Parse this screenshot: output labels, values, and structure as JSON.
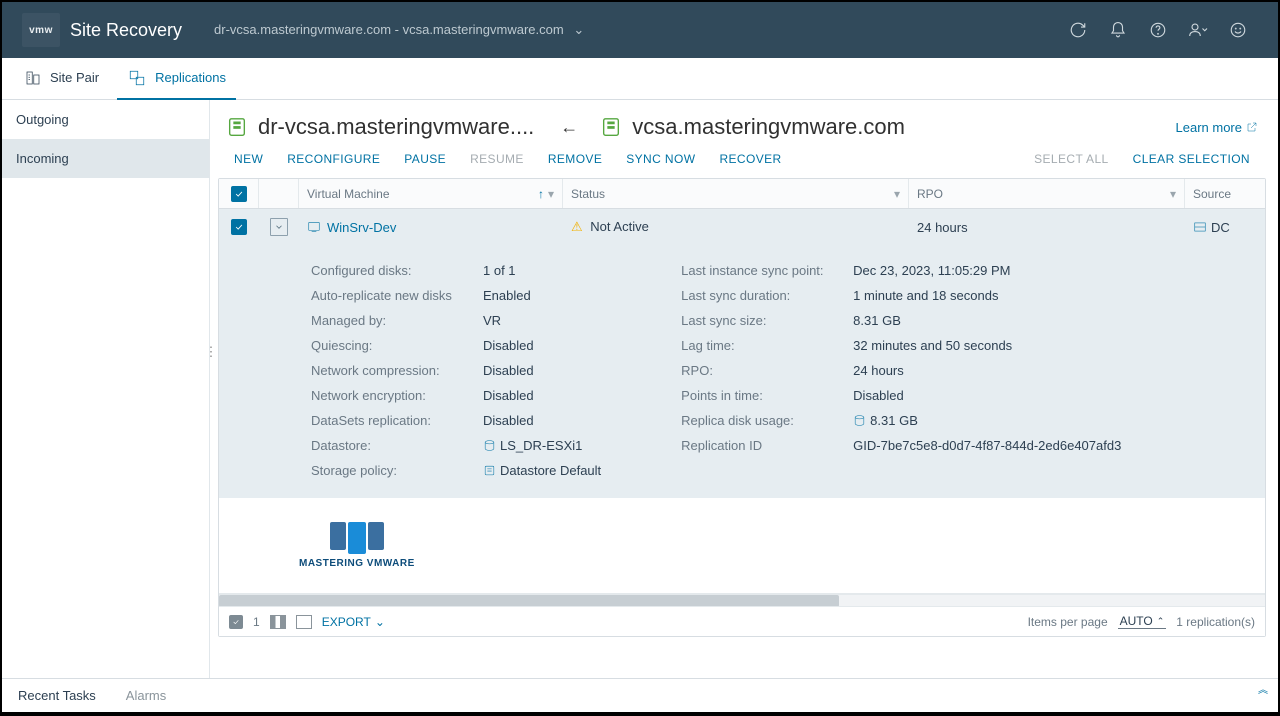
{
  "header": {
    "logo_text": "vmw",
    "app_title": "Site Recovery",
    "vcsa_pair": "dr-vcsa.masteringvmware.com - vcsa.masteringvmware.com"
  },
  "top_tabs": {
    "site_pair": "Site Pair",
    "replications": "Replications"
  },
  "sidebar": {
    "items": [
      "Outgoing",
      "Incoming"
    ]
  },
  "sites": {
    "left": "dr-vcsa.masteringvmware....",
    "right": "vcsa.masteringvmware.com",
    "learn_more": "Learn more"
  },
  "actions": {
    "new": "NEW",
    "reconfigure": "RECONFIGURE",
    "pause": "PAUSE",
    "resume": "RESUME",
    "remove": "REMOVE",
    "sync_now": "SYNC NOW",
    "recover": "RECOVER",
    "select_all": "SELECT ALL",
    "clear_selection": "CLEAR SELECTION"
  },
  "columns": {
    "vm": "Virtual Machine",
    "status": "Status",
    "rpo": "RPO",
    "source": "Source"
  },
  "row": {
    "vm_name": "WinSrv-Dev",
    "status": "Not Active",
    "rpo": "24 hours",
    "source_trunc": "DC"
  },
  "details_left": {
    "configured_disks_lbl": "Configured disks:",
    "configured_disks": "1 of 1",
    "auto_rep_lbl": "Auto-replicate new disks",
    "auto_rep": "Enabled",
    "managed_by_lbl": "Managed by:",
    "managed_by": "VR",
    "quiescing_lbl": "Quiescing:",
    "quiescing": "Disabled",
    "net_comp_lbl": "Network compression:",
    "net_comp": "Disabled",
    "net_enc_lbl": "Network encryption:",
    "net_enc": "Disabled",
    "datasets_lbl": "DataSets replication:",
    "datasets": "Disabled",
    "datastore_lbl": "Datastore:",
    "datastore": "LS_DR-ESXi1",
    "storage_policy_lbl": "Storage policy:",
    "storage_policy": "Datastore Default"
  },
  "details_right": {
    "last_sync_lbl": "Last instance sync point:",
    "last_sync": "Dec 23, 2023, 11:05:29 PM",
    "last_dur_lbl": "Last sync duration:",
    "last_dur": "1 minute and 18 seconds",
    "last_size_lbl": "Last sync size:",
    "last_size": "8.31 GB",
    "lag_lbl": "Lag time:",
    "lag": "32 minutes and 50 seconds",
    "rpo_lbl": "RPO:",
    "rpo": "24 hours",
    "pit_lbl": "Points in time:",
    "pit": "Disabled",
    "disk_usage_lbl": "Replica disk usage:",
    "disk_usage": "8.31 GB",
    "rep_id_lbl": "Replication ID",
    "rep_id": "GID-7be7c5e8-d0d7-4f87-844d-2ed6e407afd3"
  },
  "watermark": "MASTERING VMWARE",
  "footer": {
    "count": "1",
    "export": "EXPORT",
    "ipp_label": "Items per page",
    "ipp_value": "AUTO",
    "total": "1 replication(s)"
  },
  "bottom": {
    "recent_tasks": "Recent Tasks",
    "alarms": "Alarms"
  }
}
